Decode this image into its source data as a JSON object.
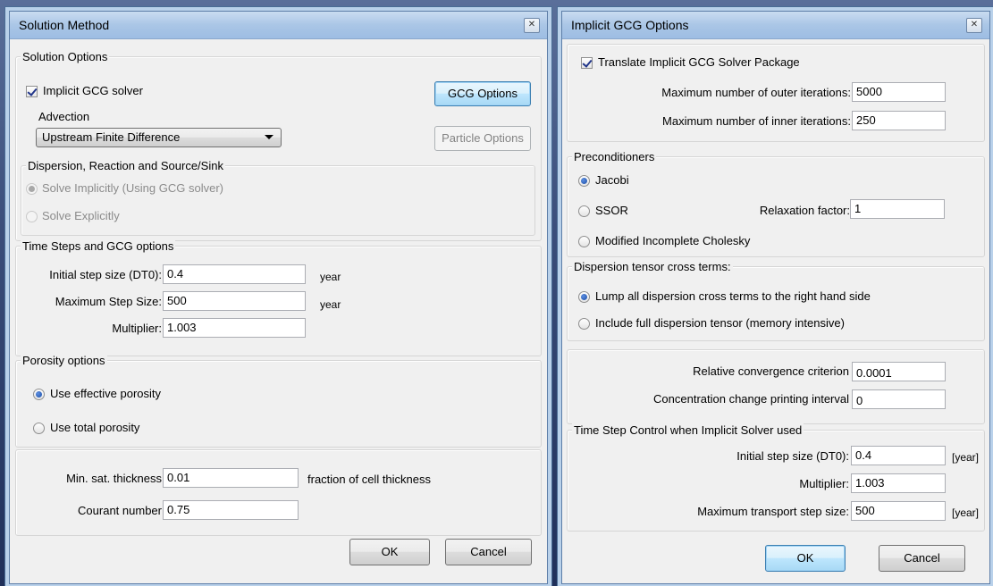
{
  "solution_method": {
    "title": "Solution Method",
    "close_glyph": "✕",
    "solution_options": {
      "title": "Solution Options",
      "implicit_gcg_label": "Implicit GCG solver",
      "implicit_gcg_checked": true,
      "gcg_options_button": "GCG Options",
      "advection_label": "Advection",
      "advection_value": "Upstream Finite Difference",
      "particle_options_button": "Particle Options"
    },
    "dispersion": {
      "title": "Dispersion, Reaction and Source/Sink",
      "solve_implicitly": "Solve Implicitly (Using GCG solver)",
      "solve_explicitly": "Solve Explicitly"
    },
    "time_steps": {
      "title": "Time Steps and GCG options",
      "initial_step_label": "Initial step size (DT0):",
      "initial_step_value": "0.4",
      "initial_step_unit": "year",
      "max_step_label": "Maximum Step Size:",
      "max_step_value": "500",
      "max_step_unit": "year",
      "multiplier_label": "Multiplier:",
      "multiplier_value": "1.003"
    },
    "porosity": {
      "title": "Porosity options",
      "effective": "Use effective porosity",
      "total": "Use total porosity"
    },
    "misc": {
      "min_sat_label": "Min. sat. thickness",
      "min_sat_value": "0.01",
      "min_sat_unit": "fraction of cell thickness",
      "courant_label": "Courant number",
      "courant_value": "0.75"
    },
    "ok_button": "OK",
    "cancel_button": "Cancel"
  },
  "implicit_gcg": {
    "title": "Implicit GCG Options",
    "close_glyph": "✕",
    "translate_label": "Translate Implicit GCG Solver Package",
    "translate_checked": true,
    "max_outer_label": "Maximum number of outer iterations:",
    "max_outer_value": "5000",
    "max_inner_label": "Maximum number of inner iterations:",
    "max_inner_value": "250",
    "preconditioners": {
      "title": "Preconditioners",
      "jacobi": "Jacobi",
      "ssor": "SSOR",
      "relaxation_label": "Relaxation factor:",
      "relaxation_value": "1",
      "mic": "Modified Incomplete Cholesky"
    },
    "dispersion_tensor": {
      "title": "Dispersion tensor cross terms:",
      "lump": "Lump all dispersion cross terms to the right hand side",
      "full": "Include full dispersion tensor (memory intensive)"
    },
    "convergence": {
      "rel_label": "Relative convergence criterion",
      "rel_value": "0.0001",
      "print_label": "Concentration change printing interval",
      "print_value": "0"
    },
    "time_step_control": {
      "title": "Time Step Control when Implicit Solver used",
      "initial_label": "Initial step size (DT0):",
      "initial_value": "0.4",
      "initial_unit": "[year]",
      "multiplier_label": "Multiplier:",
      "multiplier_value": "1.003",
      "max_label": "Maximum transport step size:",
      "max_value": "500",
      "max_unit": "[year]"
    },
    "ok_button": "OK",
    "cancel_button": "Cancel"
  }
}
